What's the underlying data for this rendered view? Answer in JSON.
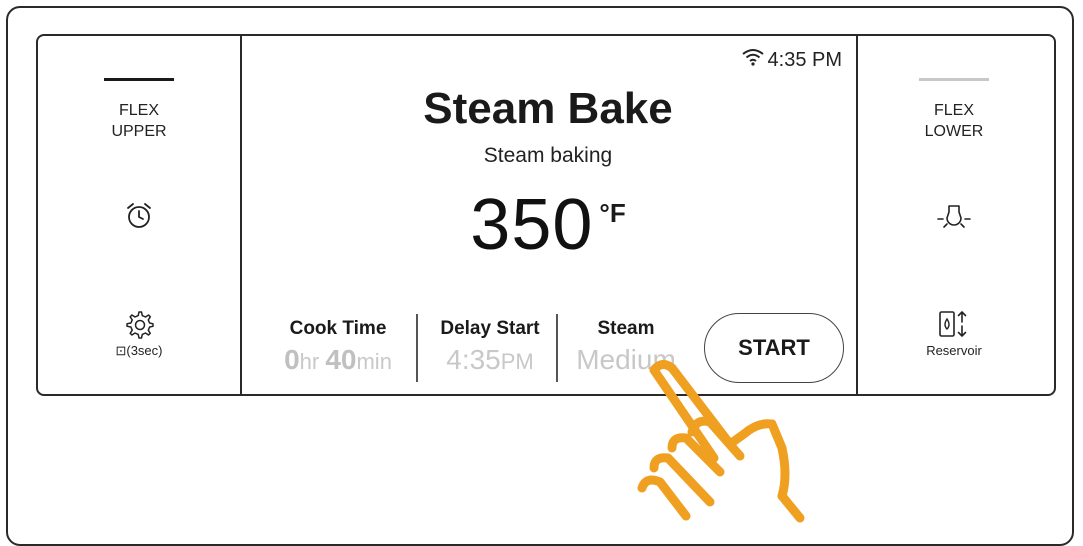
{
  "status": {
    "time": "4:35 PM",
    "wifi_icon": "wifi-icon"
  },
  "left_panel": {
    "label_line1": "FLEX",
    "label_line2": "UPPER",
    "indicator_color": "#1a1a1a",
    "timer_icon": "alarm-clock-icon",
    "settings_icon": "gear-icon",
    "lock_caption": "⊡(3sec)"
  },
  "right_panel": {
    "label_line1": "FLEX",
    "label_line2": "LOWER",
    "indicator_color": "#c8c8c8",
    "light_icon": "oven-light-icon",
    "reservoir_icon": "water-reservoir-icon",
    "reservoir_label": "Reservoir"
  },
  "main": {
    "title": "Steam Bake",
    "subtitle": "Steam baking",
    "temperature": "350",
    "temperature_unit": "°F",
    "options": [
      {
        "label": "Cook Time",
        "value_parts": [
          "0",
          "hr ",
          "40",
          "min"
        ]
      },
      {
        "label": "Delay Start",
        "value_parts": [
          "4:35",
          "PM"
        ]
      },
      {
        "label": "Steam",
        "value": "Medium"
      }
    ],
    "start_label": "START"
  },
  "colors": {
    "inactive_value": "#c8c8c8",
    "hand": "#f0a020",
    "border": "#2a2a2a"
  }
}
